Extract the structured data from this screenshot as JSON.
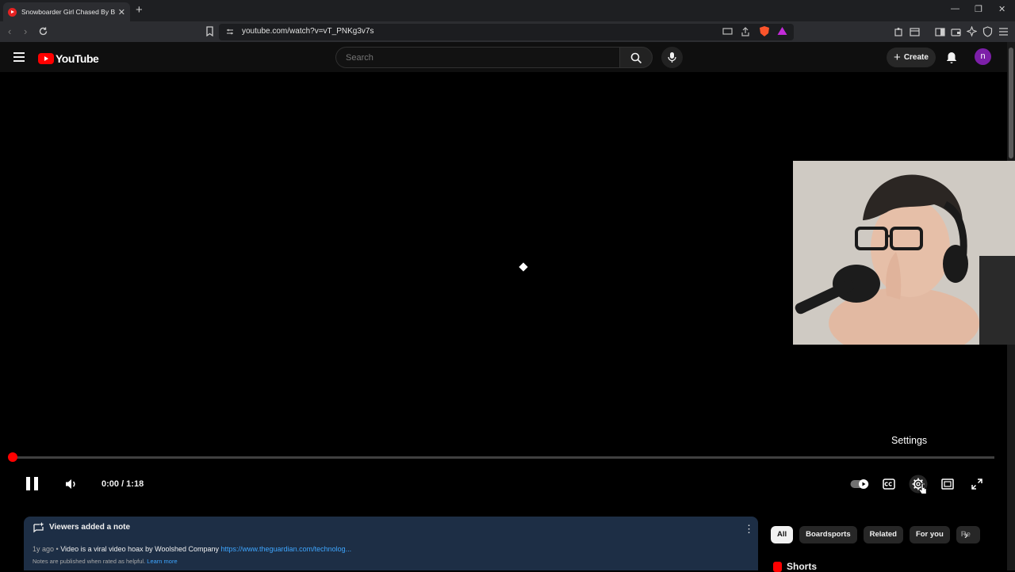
{
  "browser": {
    "tab_title": "Snowboarder Girl Chased By Bear",
    "tab_close": "✕",
    "new_tab": "+",
    "url": "youtube.com/watch?v=vT_PNKg3v7s",
    "window_controls": [
      "—",
      "❐",
      "✕"
    ]
  },
  "youtube": {
    "logo_text": "YouTube",
    "search_placeholder": "Search",
    "create_label": "Create",
    "avatar_initial": "n"
  },
  "player": {
    "tooltip": "Settings",
    "current_time": "0:00",
    "duration": "1:18",
    "time_display": "0:00 / 1:18",
    "progress_fraction": 0.0,
    "state": "playing"
  },
  "note": {
    "heading": "Viewers added a note",
    "age": "1y ago",
    "separator": "•",
    "text": "Video is a viral video hoax by Woolshed Company",
    "link": "https://www.theguardian.com/technolog...",
    "footer": "Notes are published when rated as helpful.",
    "footer_link": "Learn more"
  },
  "chips": [
    "All",
    "Boardsports",
    "Related",
    "For you",
    "Re"
  ],
  "shorts_heading": "Shorts",
  "colors": {
    "accent_red": "#ff0000",
    "note_bg": "#1d2e45",
    "link_blue": "#3ea6ff",
    "avatar_purple": "#7c1fa8"
  }
}
